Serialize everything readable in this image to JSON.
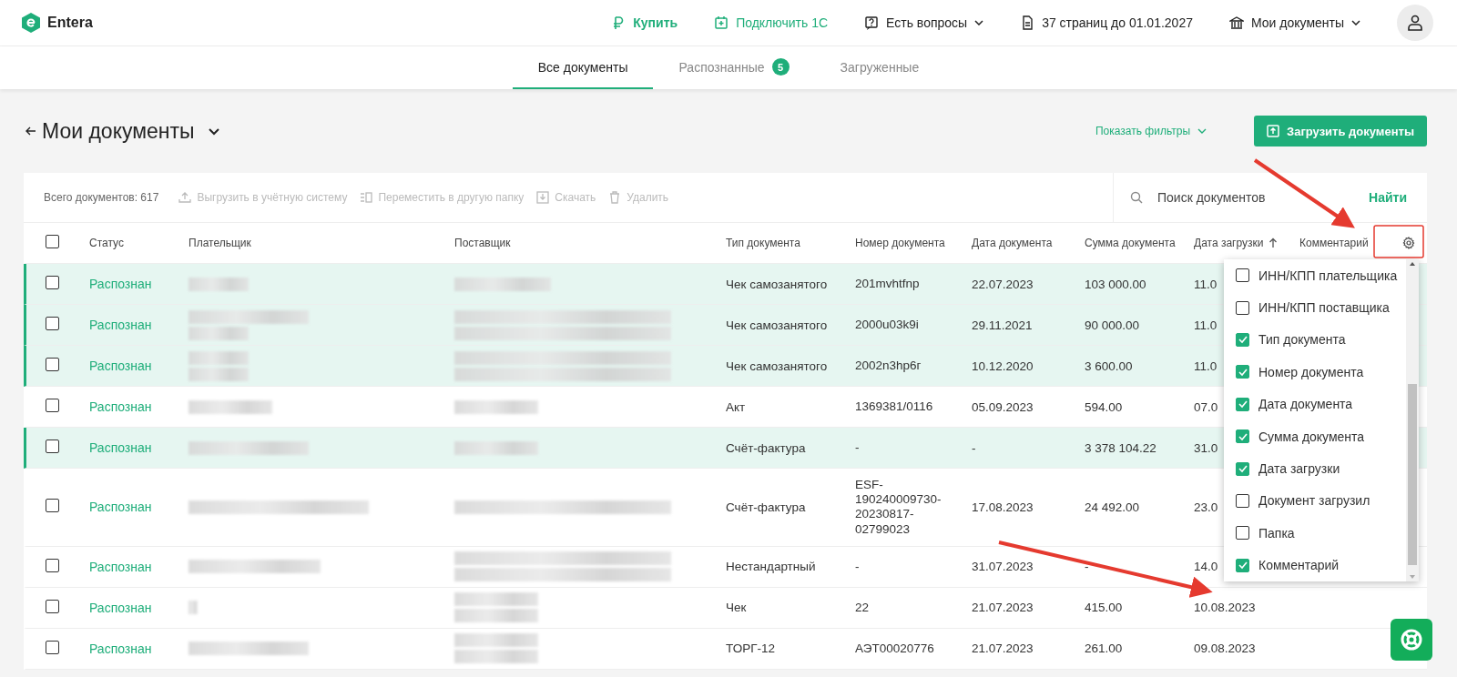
{
  "brand": "Entera",
  "top_nav": [
    {
      "kind": "buy",
      "label": "Купить"
    },
    {
      "kind": "connect",
      "label": "Подключить 1С"
    },
    {
      "kind": "help",
      "label": "Есть вопросы"
    },
    {
      "kind": "pages",
      "label": "37 страниц до 01.01.2027"
    },
    {
      "kind": "docs",
      "label": "Мои документы"
    }
  ],
  "tabs": [
    {
      "label": "Все документы",
      "selected": true
    },
    {
      "label": "Распознанные",
      "badge": "5",
      "selected": false
    },
    {
      "label": "Загруженные",
      "selected": false
    }
  ],
  "page_title": "Мои документы",
  "filters_button": "Показать фильтры",
  "upload_button": "Загрузить документы",
  "toolbar": {
    "total": "Всего документов: 617",
    "actions": [
      {
        "kind": "export",
        "label": "Выгрузить в учётную систему",
        "disabled": true
      },
      {
        "kind": "move",
        "label": "Переместить в другую папку",
        "disabled": true
      },
      {
        "kind": "download",
        "label": "Скачать",
        "disabled": true
      },
      {
        "kind": "delete",
        "label": "Удалить",
        "disabled": true
      }
    ],
    "search_placeholder": "Поиск документов",
    "search_button": "Найти"
  },
  "select_all_checked": false,
  "columns": [
    {
      "label": "Статус",
      "sorted": false
    },
    {
      "label": "Плательщик",
      "sorted": false
    },
    {
      "label": "Поставщик",
      "sorted": false
    },
    {
      "label": "Тип документа",
      "sorted": false
    },
    {
      "label": "Номер документа",
      "sorted": false
    },
    {
      "label": "Дата документа",
      "sorted": false
    },
    {
      "label": "Сумма документа",
      "sorted": false
    },
    {
      "label": "Дата загрузки",
      "sorted": true
    },
    {
      "label": "Комментарий",
      "sorted": false
    }
  ],
  "rows": [
    {
      "selected": true,
      "checked": false,
      "status": "Распознан",
      "type": "Чек самозанятого",
      "number": "201mvhtfnp",
      "date": "22.07.2023",
      "sum": "103 000.00",
      "uploaded": "11.0"
    },
    {
      "selected": true,
      "checked": false,
      "status": "Распознан",
      "type": "Чек самозанятого",
      "number": "2000u03k9i",
      "date": "29.11.2021",
      "sum": "90 000.00",
      "uploaded": "11.0"
    },
    {
      "selected": true,
      "checked": false,
      "status": "Распознан",
      "type": "Чек самозанятого",
      "number": "2002n3hp6г",
      "date": "10.12.2020",
      "sum": "3 600.00",
      "uploaded": "11.0"
    },
    {
      "selected": false,
      "checked": false,
      "status": "Распознан",
      "type": "Акт",
      "number": "1369381/0116",
      "date": "05.09.2023",
      "sum": "594.00",
      "uploaded": "07.0"
    },
    {
      "selected": true,
      "checked": false,
      "status": "Распознан",
      "type": "Счёт-фактура",
      "number": "-",
      "date": "-",
      "sum": "3 378 104.22",
      "uploaded": "31.0"
    },
    {
      "selected": false,
      "checked": false,
      "status": "Распознан",
      "type": "Счёт-фактура",
      "number": "ESF-190240009730-20230817-02799023",
      "date": "17.08.2023",
      "sum": "24 492.00",
      "uploaded": "23.0"
    },
    {
      "selected": false,
      "checked": false,
      "status": "Распознан",
      "type": "Нестандартный",
      "number": "-",
      "date": "31.07.2023",
      "sum": "-",
      "uploaded": "14.0"
    },
    {
      "selected": false,
      "checked": false,
      "status": "Распознан",
      "type": "Чек",
      "number": "22",
      "date": "21.07.2023",
      "sum": "415.00",
      "uploaded": "10.08.2023"
    },
    {
      "selected": false,
      "checked": false,
      "status": "Распознан",
      "type": "ТОРГ-12",
      "number": "АЭТ00020776",
      "date": "21.07.2023",
      "sum": "261.00",
      "uploaded": "09.08.2023"
    }
  ],
  "column_menu": [
    {
      "label": "ИНН/КПП плательщика",
      "checked": false
    },
    {
      "label": "ИНН/КПП поставщика",
      "checked": false
    },
    {
      "label": "Тип документа",
      "checked": true
    },
    {
      "label": "Номер документа",
      "checked": true
    },
    {
      "label": "Дата документа",
      "checked": true
    },
    {
      "label": "Сумма документа",
      "checked": true
    },
    {
      "label": "Дата загрузки",
      "checked": true
    },
    {
      "label": "Документ загрузил",
      "checked": false
    },
    {
      "label": "Папка",
      "checked": false
    },
    {
      "label": "Комментарий",
      "checked": true
    }
  ]
}
